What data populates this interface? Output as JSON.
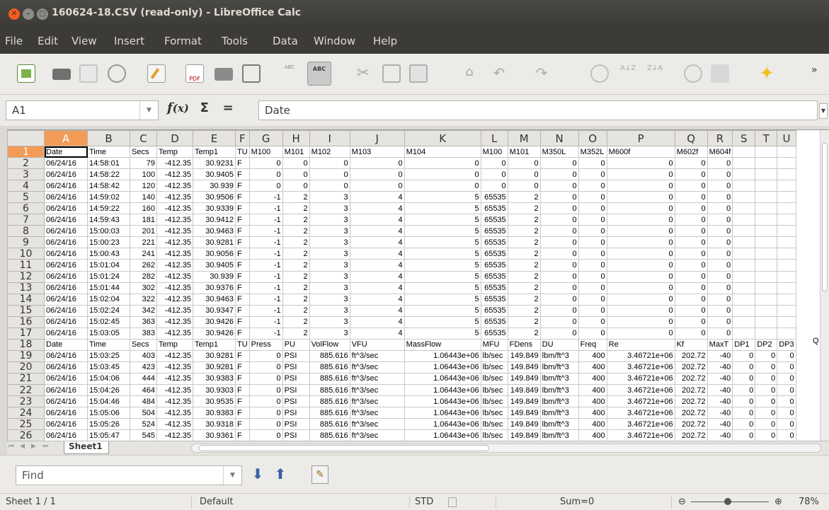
{
  "window": {
    "title": "160624-18.CSV (read-only) - LibreOffice Calc"
  },
  "menu": [
    "File",
    "Edit",
    "View",
    "Insert",
    "Format",
    "Tools",
    "Data",
    "Window",
    "Help"
  ],
  "formula_bar": {
    "name_box": "A1",
    "formula": "Date"
  },
  "columns": [
    "A",
    "B",
    "C",
    "D",
    "E",
    "F",
    "G",
    "H",
    "I",
    "J",
    "K",
    "L",
    "M",
    "N",
    "O",
    "P",
    "Q",
    "R",
    "S",
    "T",
    "U"
  ],
  "rows": [
    [
      "Date",
      "Time",
      "Secs",
      "Temp",
      "Temp1",
      "TU",
      "M100",
      "M101",
      "M102",
      "M103",
      "M104",
      "M100",
      "M101",
      "M350L",
      "M352L",
      "M600f",
      "M602f",
      "M604f",
      "",
      "",
      ""
    ],
    [
      "06/24/16",
      "14:58:01",
      "79",
      "-412.35",
      "30.9231",
      "F",
      "0",
      "0",
      "0",
      "0",
      "0",
      "0",
      "0",
      "0",
      "0",
      "0",
      "0",
      "0",
      "",
      "",
      ""
    ],
    [
      "06/24/16",
      "14:58:22",
      "100",
      "-412.35",
      "30.9405",
      "F",
      "0",
      "0",
      "0",
      "0",
      "0",
      "0",
      "0",
      "0",
      "0",
      "0",
      "0",
      "0",
      "",
      "",
      ""
    ],
    [
      "06/24/16",
      "14:58:42",
      "120",
      "-412.35",
      "30.939",
      "F",
      "0",
      "0",
      "0",
      "0",
      "0",
      "0",
      "0",
      "0",
      "0",
      "0",
      "0",
      "0",
      "",
      "",
      ""
    ],
    [
      "06/24/16",
      "14:59:02",
      "140",
      "-412.35",
      "30.9506",
      "F",
      "-1",
      "2",
      "3",
      "4",
      "5",
      "65535",
      "2",
      "0",
      "0",
      "0",
      "0",
      "0",
      "",
      "",
      ""
    ],
    [
      "06/24/16",
      "14:59:22",
      "160",
      "-412.35",
      "30.9339",
      "F",
      "-1",
      "2",
      "3",
      "4",
      "5",
      "65535",
      "2",
      "0",
      "0",
      "0",
      "0",
      "0",
      "",
      "",
      ""
    ],
    [
      "06/24/16",
      "14:59:43",
      "181",
      "-412.35",
      "30.9412",
      "F",
      "-1",
      "2",
      "3",
      "4",
      "5",
      "65535",
      "2",
      "0",
      "0",
      "0",
      "0",
      "0",
      "",
      "",
      ""
    ],
    [
      "06/24/16",
      "15:00:03",
      "201",
      "-412.35",
      "30.9463",
      "F",
      "-1",
      "2",
      "3",
      "4",
      "5",
      "65535",
      "2",
      "0",
      "0",
      "0",
      "0",
      "0",
      "",
      "",
      ""
    ],
    [
      "06/24/16",
      "15:00:23",
      "221",
      "-412.35",
      "30.9281",
      "F",
      "-1",
      "2",
      "3",
      "4",
      "5",
      "65535",
      "2",
      "0",
      "0",
      "0",
      "0",
      "0",
      "",
      "",
      ""
    ],
    [
      "06/24/16",
      "15:00:43",
      "241",
      "-412.35",
      "30.9056",
      "F",
      "-1",
      "2",
      "3",
      "4",
      "5",
      "65535",
      "2",
      "0",
      "0",
      "0",
      "0",
      "0",
      "",
      "",
      ""
    ],
    [
      "06/24/16",
      "15:01:04",
      "262",
      "-412.35",
      "30.9405",
      "F",
      "-1",
      "2",
      "3",
      "4",
      "5",
      "65535",
      "2",
      "0",
      "0",
      "0",
      "0",
      "0",
      "",
      "",
      ""
    ],
    [
      "06/24/16",
      "15:01:24",
      "282",
      "-412.35",
      "30.939",
      "F",
      "-1",
      "2",
      "3",
      "4",
      "5",
      "65535",
      "2",
      "0",
      "0",
      "0",
      "0",
      "0",
      "",
      "",
      ""
    ],
    [
      "06/24/16",
      "15:01:44",
      "302",
      "-412.35",
      "30.9376",
      "F",
      "-1",
      "2",
      "3",
      "4",
      "5",
      "65535",
      "2",
      "0",
      "0",
      "0",
      "0",
      "0",
      "",
      "",
      ""
    ],
    [
      "06/24/16",
      "15:02:04",
      "322",
      "-412.35",
      "30.9463",
      "F",
      "-1",
      "2",
      "3",
      "4",
      "5",
      "65535",
      "2",
      "0",
      "0",
      "0",
      "0",
      "0",
      "",
      "",
      ""
    ],
    [
      "06/24/16",
      "15:02:24",
      "342",
      "-412.35",
      "30.9347",
      "F",
      "-1",
      "2",
      "3",
      "4",
      "5",
      "65535",
      "2",
      "0",
      "0",
      "0",
      "0",
      "0",
      "",
      "",
      ""
    ],
    [
      "06/24/16",
      "15:02:45",
      "363",
      "-412.35",
      "30.9426",
      "F",
      "-1",
      "2",
      "3",
      "4",
      "5",
      "65535",
      "2",
      "0",
      "0",
      "0",
      "0",
      "0",
      "",
      "",
      ""
    ],
    [
      "06/24/16",
      "15:03:05",
      "383",
      "-412.35",
      "30.9426",
      "F",
      "-1",
      "2",
      "3",
      "4",
      "5",
      "65535",
      "2",
      "0",
      "0",
      "0",
      "0",
      "0",
      "",
      "",
      ""
    ],
    [
      "Date",
      "Time",
      "Secs",
      "Temp",
      "Temp1",
      "TU",
      "Press",
      "PU",
      "VolFlow",
      "VFU",
      "MassFlow",
      "MFU",
      "FDens",
      "DU",
      "Freq",
      "Re",
      "Kf",
      "MaxT",
      "DP1",
      "DP2",
      "DP3"
    ],
    [
      "06/24/16",
      "15:03:25",
      "403",
      "-412.35",
      "30.9281",
      "F",
      "0",
      "PSI",
      "885.616",
      "ft^3/sec",
      "1.06443e+06",
      "lb/sec",
      "149.849",
      "lbm/ft^3",
      "400",
      "3.46721e+06",
      "202.72",
      "-40",
      "0",
      "0",
      "0"
    ],
    [
      "06/24/16",
      "15:03:45",
      "423",
      "-412.35",
      "30.9281",
      "F",
      "0",
      "PSI",
      "885.616",
      "ft^3/sec",
      "1.06443e+06",
      "lb/sec",
      "149.849",
      "lbm/ft^3",
      "400",
      "3.46721e+06",
      "202.72",
      "-40",
      "0",
      "0",
      "0"
    ],
    [
      "06/24/16",
      "15:04:06",
      "444",
      "-412.35",
      "30.9383",
      "F",
      "0",
      "PSI",
      "885.616",
      "ft^3/sec",
      "1.06443e+06",
      "lb/sec",
      "149.849",
      "lbm/ft^3",
      "400",
      "3.46721e+06",
      "202.72",
      "-40",
      "0",
      "0",
      "0"
    ],
    [
      "06/24/16",
      "15:04:26",
      "464",
      "-412.35",
      "30.9303",
      "F",
      "0",
      "PSI",
      "885.616",
      "ft^3/sec",
      "1.06443e+06",
      "lb/sec",
      "149.849",
      "lbm/ft^3",
      "400",
      "3.46721e+06",
      "202.72",
      "-40",
      "0",
      "0",
      "0"
    ],
    [
      "06/24/16",
      "15:04:46",
      "484",
      "-412.35",
      "30.9535",
      "F",
      "0",
      "PSI",
      "885.616",
      "ft^3/sec",
      "1.06443e+06",
      "lb/sec",
      "149.849",
      "lbm/ft^3",
      "400",
      "3.46721e+06",
      "202.72",
      "-40",
      "0",
      "0",
      "0"
    ],
    [
      "06/24/16",
      "15:05:06",
      "504",
      "-412.35",
      "30.9383",
      "F",
      "0",
      "PSI",
      "885.616",
      "ft^3/sec",
      "1.06443e+06",
      "lb/sec",
      "149.849",
      "lbm/ft^3",
      "400",
      "3.46721e+06",
      "202.72",
      "-40",
      "0",
      "0",
      "0"
    ],
    [
      "06/24/16",
      "15:05:26",
      "524",
      "-412.35",
      "30.9318",
      "F",
      "0",
      "PSI",
      "885.616",
      "ft^3/sec",
      "1.06443e+06",
      "lb/sec",
      "149.849",
      "lbm/ft^3",
      "400",
      "3.46721e+06",
      "202.72",
      "-40",
      "0",
      "0",
      "0"
    ],
    [
      "06/24/16",
      "15:05:47",
      "545",
      "-412.35",
      "30.9361",
      "F",
      "0",
      "PSI",
      "885.616",
      "ft^3/sec",
      "1.06443e+06",
      "lb/sec",
      "149.849",
      "lbm/ft^3",
      "400",
      "3.46721e+06",
      "202.72",
      "-40",
      "0",
      "0",
      "0"
    ],
    [
      "",
      "",
      "",
      "",
      "",
      "",
      "",
      "",
      "",
      "",
      "",
      "",
      "",
      "",
      "",
      "",
      "",
      "",
      "",
      "",
      ""
    ]
  ],
  "overflow_text": "Q",
  "sheet_tab": "Sheet1",
  "find": {
    "placeholder": "Find"
  },
  "status": {
    "sheet": "Sheet 1 / 1",
    "style": "Default",
    "mode": "STD",
    "sum": "Sum=0",
    "zoom": "78%"
  },
  "colors": {
    "accent": "#f39c58",
    "titlebar": "#3c3b37"
  }
}
